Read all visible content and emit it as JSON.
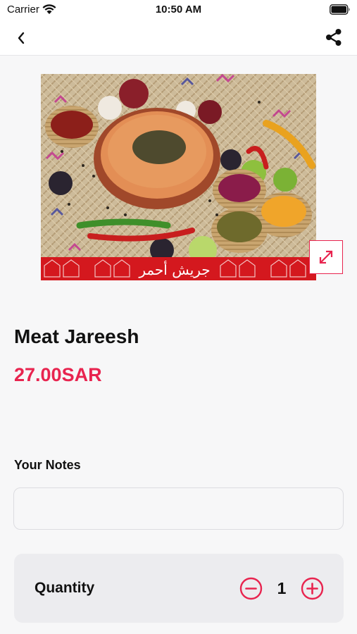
{
  "status_bar": {
    "carrier": "Carrier",
    "time": "10:50 AM"
  },
  "nav": {
    "back_icon": "chevron-left-icon",
    "share_icon": "share-icon"
  },
  "image": {
    "caption_arabic": "جريش أحمر",
    "expand_icon": "expand-arrows-icon"
  },
  "item": {
    "title": "Meat Jareesh",
    "price": "27.00SAR"
  },
  "notes": {
    "label": "Your Notes",
    "value": "",
    "placeholder": ""
  },
  "quantity": {
    "label": "Quantity",
    "value": "1",
    "minus_icon": "minus-circle-icon",
    "plus_icon": "plus-circle-icon"
  },
  "colors": {
    "accent": "#e8244f",
    "background": "#f7f7f8",
    "card": "#ececef"
  }
}
